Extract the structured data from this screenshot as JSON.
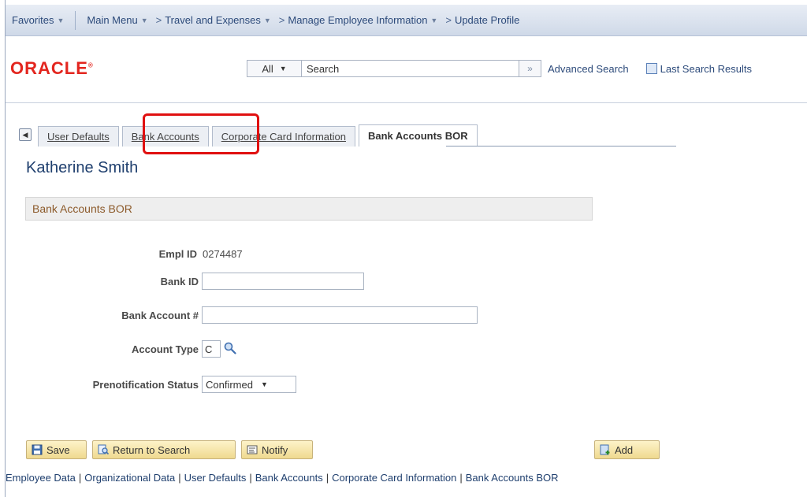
{
  "navbar": {
    "favorites": "Favorites",
    "main_menu": "Main Menu",
    "crumbs": [
      "Travel and Expenses",
      "Manage Employee Information",
      "Update Profile"
    ]
  },
  "header": {
    "logo": "ORACLE",
    "search_scope": "All",
    "search_placeholder": "Search",
    "advanced_search": "Advanced Search",
    "last_search": "Last Search Results"
  },
  "tabs": [
    {
      "label": "User Defaults",
      "active": false
    },
    {
      "label": "Bank Accounts",
      "active": false
    },
    {
      "label": "Corporate Card Information",
      "active": false
    },
    {
      "label": "Bank Accounts BOR",
      "active": true
    }
  ],
  "person_name": "Katherine Smith",
  "section_title": "Bank Accounts BOR",
  "form": {
    "empl_id_label": "Empl ID",
    "empl_id_value": "0274487",
    "bank_id_label": "Bank ID",
    "bank_id_value": "",
    "bank_account_label": "Bank Account #",
    "bank_account_value": "",
    "account_type_label": "Account Type",
    "account_type_value": "C",
    "prenote_label": "Prenotification Status",
    "prenote_value": "Confirmed"
  },
  "buttons": {
    "save": "Save",
    "return": "Return to Search",
    "notify": "Notify",
    "add": "Add"
  },
  "footer_links": [
    "Employee Data",
    "Organizational Data",
    "User Defaults",
    "Bank Accounts",
    "Corporate Card Information",
    "Bank Accounts BOR"
  ],
  "colors": {
    "logo_red": "#e3261f",
    "highlight_red": "#e01010",
    "link_blue": "#1f3f6e",
    "button_gold": "#efd98f"
  }
}
